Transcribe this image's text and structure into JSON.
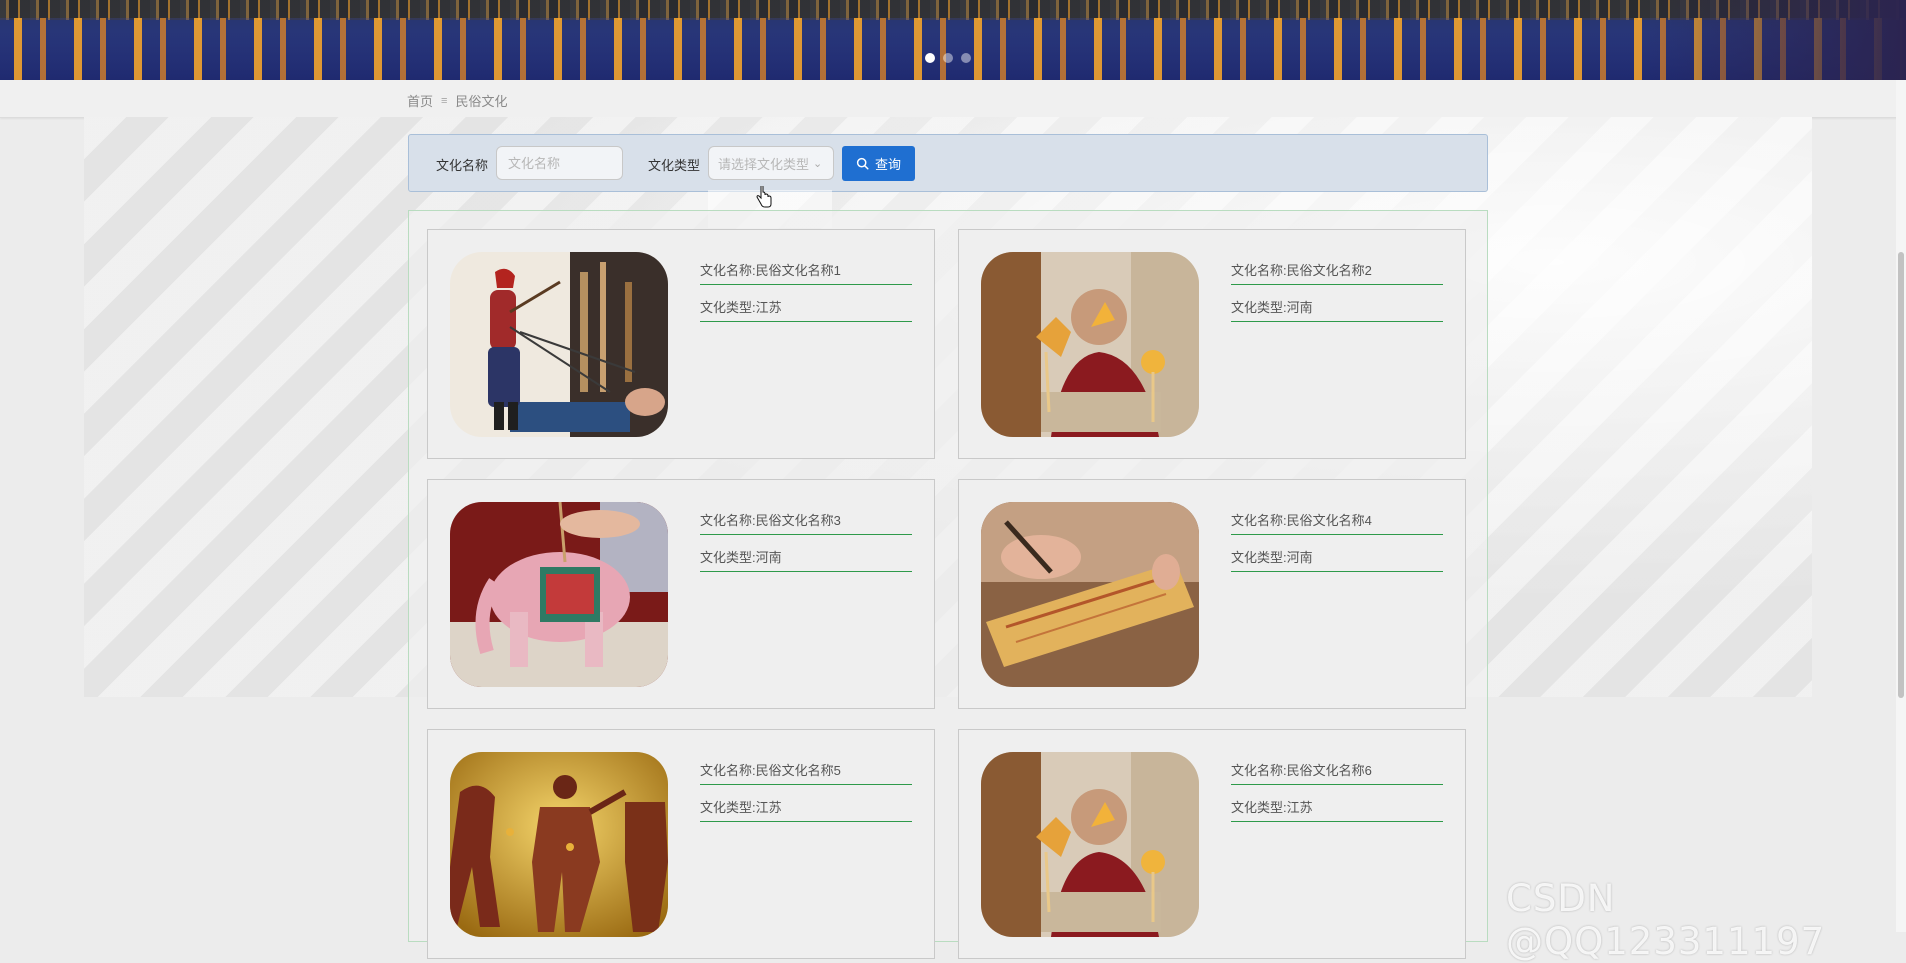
{
  "banner": {
    "slide_count": 3,
    "active_slide": 1
  },
  "breadcrumb": {
    "home": "首页",
    "separator": "≡",
    "current": "民俗文化"
  },
  "search": {
    "name_label": "文化名称",
    "name_placeholder": "文化名称",
    "type_label": "文化类型",
    "type_placeholder": "请选择文化类型",
    "button_label": "查询"
  },
  "cards": [
    {
      "name_label": "文化名称:",
      "name": "民俗文化名称1",
      "type_label": "文化类型:",
      "type": "江苏",
      "image": "shadow-puppet-performer-image"
    },
    {
      "name_label": "文化名称:",
      "name": "民俗文化名称2",
      "type_label": "文化类型:",
      "type": "河南",
      "image": "artisan-with-puppets-image"
    },
    {
      "name_label": "文化名称:",
      "name": "民俗文化名称3",
      "type_label": "文化类型:",
      "type": "河南",
      "image": "painted-elephant-image"
    },
    {
      "name_label": "文化名称:",
      "name": "民俗文化名称4",
      "type_label": "文化类型:",
      "type": "河南",
      "image": "scroll-carving-image"
    },
    {
      "name_label": "文化名称:",
      "name": "民俗文化名称5",
      "type_label": "文化类型:",
      "type": "江苏",
      "image": "shadow-figures-image"
    },
    {
      "name_label": "文化名称:",
      "name": "民俗文化名称6",
      "type_label": "文化类型:",
      "type": "江苏",
      "image": "artisan-with-puppets-image"
    }
  ],
  "colors": {
    "primary_button": "#1f6fd1",
    "card_divider": "#2e9a4a",
    "search_bg": "#d8e0ea"
  },
  "watermark": "CSDN @QQ123311197"
}
